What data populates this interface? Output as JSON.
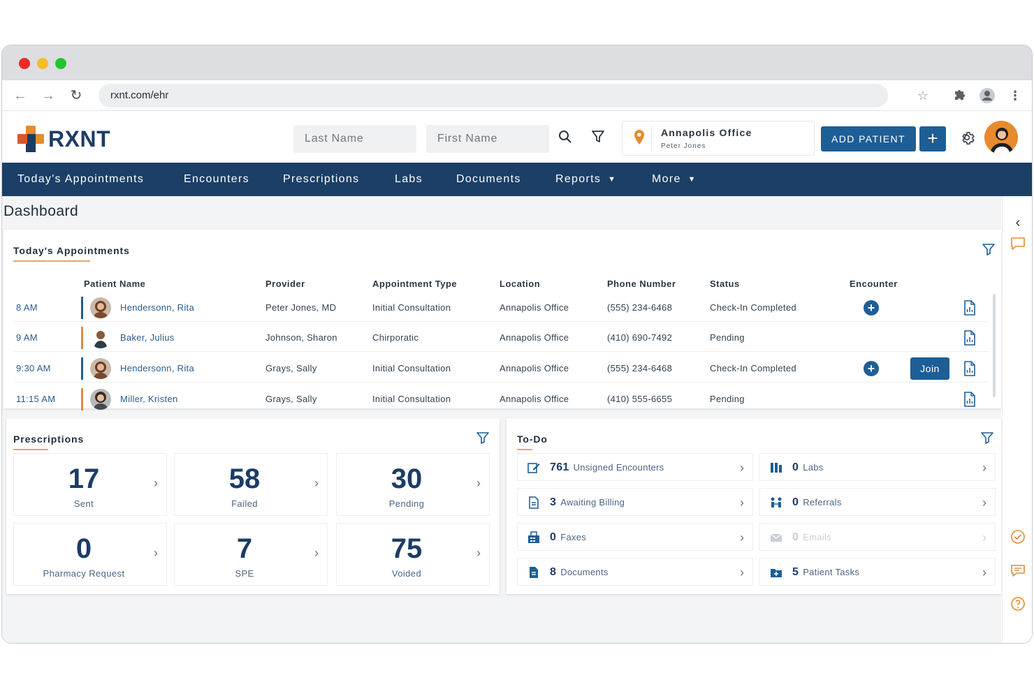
{
  "browser": {
    "url": "rxnt.com/ehr"
  },
  "header": {
    "logo_text": "RXNT",
    "last_name_placeholder": "Last Name",
    "first_name_placeholder": "First Name",
    "location": {
      "office": "Annapolis Office",
      "user": "Peter Jones"
    },
    "add_patient_label": "ADD PATIENT",
    "add_plus_label": "+"
  },
  "nav": {
    "items": [
      {
        "label": "Today's Appointments"
      },
      {
        "label": "Encounters"
      },
      {
        "label": "Prescriptions"
      },
      {
        "label": "Labs"
      },
      {
        "label": "Documents"
      },
      {
        "label": "Reports"
      },
      {
        "label": "More"
      }
    ]
  },
  "dashboard": {
    "title": "Dashboard",
    "appointments": {
      "title": "Today's Appointments",
      "columns": [
        "Patient Name",
        "Provider",
        "Appointment Type",
        "Location",
        "Phone Number",
        "Status",
        "Encounter"
      ],
      "rows": [
        {
          "time": "8 AM",
          "patient": "Hendersonn, Rita",
          "provider": "Peter Jones, MD",
          "type": "Initial Consultation",
          "location": "Annapolis Office",
          "phone": "(555) 234-6468",
          "status": "Check-In Completed",
          "encounter_plus": true,
          "join": false,
          "bar_color": "#1d5e97"
        },
        {
          "time": "9 AM",
          "patient": "Baker, Julius",
          "provider": "Johnson, Sharon",
          "type": "Chirporatic",
          "location": "Annapolis Office",
          "phone": "(410) 690-7492",
          "status": "Pending",
          "encounter_plus": false,
          "join": false,
          "bar_color": "#e08a3c"
        },
        {
          "time": "9:30 AM",
          "patient": "Hendersonn, Rita",
          "provider": "Grays, Sally",
          "type": "Initial Consultation",
          "location": "Annapolis Office",
          "phone": "(555) 234-6468",
          "status": "Check-In Completed",
          "encounter_plus": true,
          "join": true,
          "join_label": "Join",
          "bar_color": "#1d5e97"
        },
        {
          "time": "11:15 AM",
          "patient": "Miller, Kristen",
          "provider": "Grays, Sally",
          "type": "Initial Consultation",
          "location": "Annapolis Office",
          "phone": "(410) 555-6655",
          "status": "Pending",
          "encounter_plus": false,
          "join": false,
          "bar_color": "#e08a3c"
        }
      ]
    },
    "prescriptions": {
      "title": "Prescriptions",
      "tiles": [
        {
          "value": "17",
          "label": "Sent"
        },
        {
          "value": "58",
          "label": "Failed"
        },
        {
          "value": "30",
          "label": "Pending"
        },
        {
          "value": "0",
          "label": "Pharmacy Request"
        },
        {
          "value": "7",
          "label": "SPE"
        },
        {
          "value": "75",
          "label": "Voided"
        }
      ]
    },
    "todo": {
      "title": "To-Do",
      "items": [
        {
          "count": "761",
          "label": "Unsigned Encounters",
          "icon": "edit-icon"
        },
        {
          "count": "0",
          "label": "Labs",
          "icon": "lab-icon"
        },
        {
          "count": "3",
          "label": "Awaiting Billing",
          "icon": "billing-icon"
        },
        {
          "count": "0",
          "label": "Referrals",
          "icon": "referral-icon"
        },
        {
          "count": "0",
          "label": "Faxes",
          "icon": "fax-icon"
        },
        {
          "count": "0",
          "label": "Emails",
          "icon": "email-icon",
          "dim": true
        },
        {
          "count": "8",
          "label": "Documents",
          "icon": "document-icon"
        },
        {
          "count": "5",
          "label": "Patient Tasks",
          "icon": "task-icon"
        }
      ]
    }
  },
  "colors": {
    "brand_navy": "#1b3f66",
    "brand_blue": "#1d5e97",
    "brand_orange": "#e88a2e"
  }
}
